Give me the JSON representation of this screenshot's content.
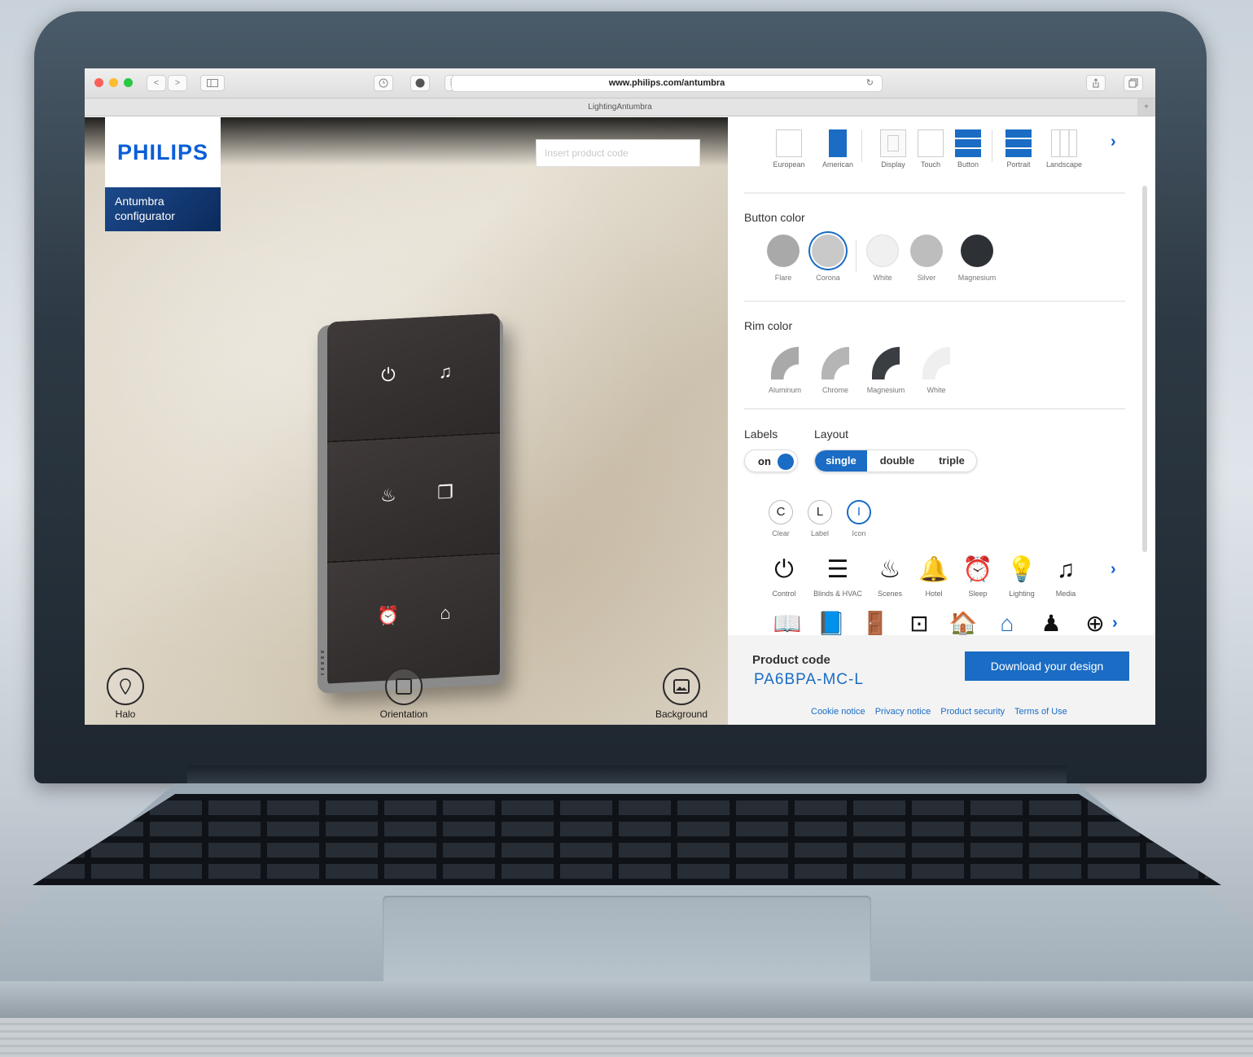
{
  "browser": {
    "url": "www.philips.com/antumbra",
    "tab_title": "LightingAntumbra",
    "nav_back": "<",
    "nav_forward": ">"
  },
  "viewer": {
    "brand": "PHILIPS",
    "app_name_line1": "Antumbra",
    "app_name_line2": "configurator",
    "code_placeholder": "Insert product code",
    "controls": [
      {
        "label": "Halo"
      },
      {
        "label": "Orientation"
      },
      {
        "label": "Background"
      }
    ]
  },
  "options": {
    "items": [
      {
        "label": "European"
      },
      {
        "label": "American"
      },
      {
        "label": "Display"
      },
      {
        "label": "Touch"
      },
      {
        "label": "Button"
      },
      {
        "label": "Portrait"
      },
      {
        "label": "Landscape"
      }
    ],
    "more": "›"
  },
  "button_color": {
    "title": "Button color",
    "swatches": [
      {
        "label": "Flare",
        "color": "#a9a9a9"
      },
      {
        "label": "Corona",
        "color": "#c9c9c9"
      },
      {
        "label": "White",
        "color": "#f0f0f0"
      },
      {
        "label": "Silver",
        "color": "#bdbdbd"
      },
      {
        "label": "Magnesium",
        "color": "#2d3035"
      }
    ]
  },
  "rim_color": {
    "title": "Rim color",
    "swatches": [
      {
        "label": "Aluminum",
        "color": "#a9a9a9"
      },
      {
        "label": "Chrome",
        "color": "#b5b5b5"
      },
      {
        "label": "Magnesium",
        "color": "#3a3d42"
      },
      {
        "label": "White",
        "color": "#efefef"
      }
    ]
  },
  "labels": {
    "title": "Labels",
    "toggle": "on"
  },
  "layout": {
    "title": "Layout",
    "options": [
      "single",
      "double",
      "triple"
    ]
  },
  "label_modes": [
    {
      "glyph": "C",
      "label": "Clear"
    },
    {
      "glyph": "L",
      "label": "Label"
    },
    {
      "glyph": "I",
      "label": "Icon"
    }
  ],
  "icon_categories": [
    {
      "glyph": "⏻",
      "label": "Control"
    },
    {
      "glyph": "☰",
      "label": "Blinds & HVAC"
    },
    {
      "glyph": "♨",
      "label": "Scenes"
    },
    {
      "glyph": "🔔",
      "label": "Hotel"
    },
    {
      "glyph": "⏰",
      "label": "Sleep"
    },
    {
      "glyph": "💡",
      "label": "Lighting"
    },
    {
      "glyph": "♫",
      "label": "Media"
    }
  ],
  "icon_glyphs": [
    "📖",
    "📘",
    "🚪",
    "⊡",
    "🏠",
    "⌂",
    "♟",
    "⊕"
  ],
  "footer": {
    "product_code_label": "Product code",
    "product_code": "PA6BPA-MC-L",
    "download_label": "Download your design",
    "links": [
      "Cookie notice",
      "Privacy notice",
      "Product security",
      "Terms of Use"
    ]
  },
  "colors": {
    "accent": "#1a6cc4",
    "philips_blue": "#0b5ed7"
  }
}
